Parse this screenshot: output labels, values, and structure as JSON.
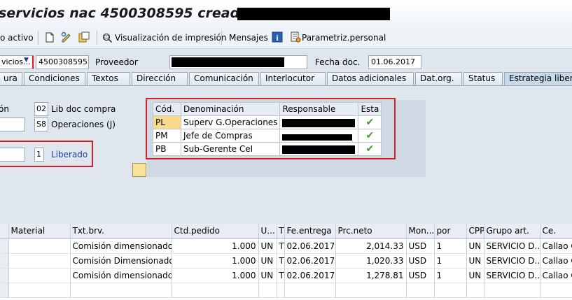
{
  "title": "servicios nac 4500308595 creado por L",
  "toolbar": {
    "activo_label": "o activo",
    "print_preview_label": "Visualización de impresión",
    "messages_label": "Mensajes",
    "personal_settings_label": "Parametriz.personal"
  },
  "header": {
    "doc_type_value": "vicios...",
    "doc_number": "4500308595",
    "vendor_label": "Proveedor",
    "doc_date_label": "Fecha doc.",
    "doc_date_value": "01.06.2017"
  },
  "tabs": [
    {
      "label": "ura"
    },
    {
      "label": "Condiciones"
    },
    {
      "label": "Textos"
    },
    {
      "label": "Dirección"
    },
    {
      "label": "Comunicación"
    },
    {
      "label": "Interlocutor"
    },
    {
      "label": "Datos adicionales"
    },
    {
      "label": "Dat.org."
    },
    {
      "label": "Status"
    },
    {
      "label": "Estrategia libera"
    }
  ],
  "release": {
    "group_label_partial": "ón",
    "group_code": "02",
    "group_text": "Lib doc compra",
    "strategy_code": "S8",
    "strategy_text": "Operaciones (J)",
    "indicator_code": "1",
    "indicator_text": "Liberado",
    "columns": [
      "Cód.",
      "Denominación",
      "Responsable",
      "Esta"
    ],
    "rows": [
      {
        "code": "PL",
        "name": "Superv G.Operaciones"
      },
      {
        "code": "PM",
        "name": "Jefe de Compras"
      },
      {
        "code": "PB",
        "name": "Sub-Gerente CeI"
      }
    ]
  },
  "items": {
    "columns": [
      "Material",
      "Txt.brv.",
      "Ctd.pedido",
      "U...",
      "T",
      "Fe.entrega",
      "Prc.neto",
      "Mon...",
      "por",
      "CPP",
      "Grupo art.",
      "Ce."
    ],
    "rows": [
      [
        "",
        "Comisión dimensionado S...",
        "1.000",
        "UN",
        "T",
        "02.06.2017",
        "2,014.33",
        "USD",
        "1",
        "UN",
        "SERVICIO D...",
        "Callao CD"
      ],
      [
        "",
        "Comisión Dimensionado S...",
        "1.000",
        "UN",
        "T",
        "02.06.2017",
        "1,020.33",
        "USD",
        "1",
        "UN",
        "SERVICIO D...",
        "Callao CD"
      ],
      [
        "",
        "Comisión dimensionado A...",
        "1.000",
        "UN",
        "T",
        "02.06.2017",
        "1,278.81",
        "USD",
        "1",
        "UN",
        "SERVICIO D...",
        "Callao CD"
      ]
    ]
  },
  "colors": {
    "highlight": "#d0202a",
    "link": "#1f3fa8",
    "check": "#3c9a2c"
  }
}
